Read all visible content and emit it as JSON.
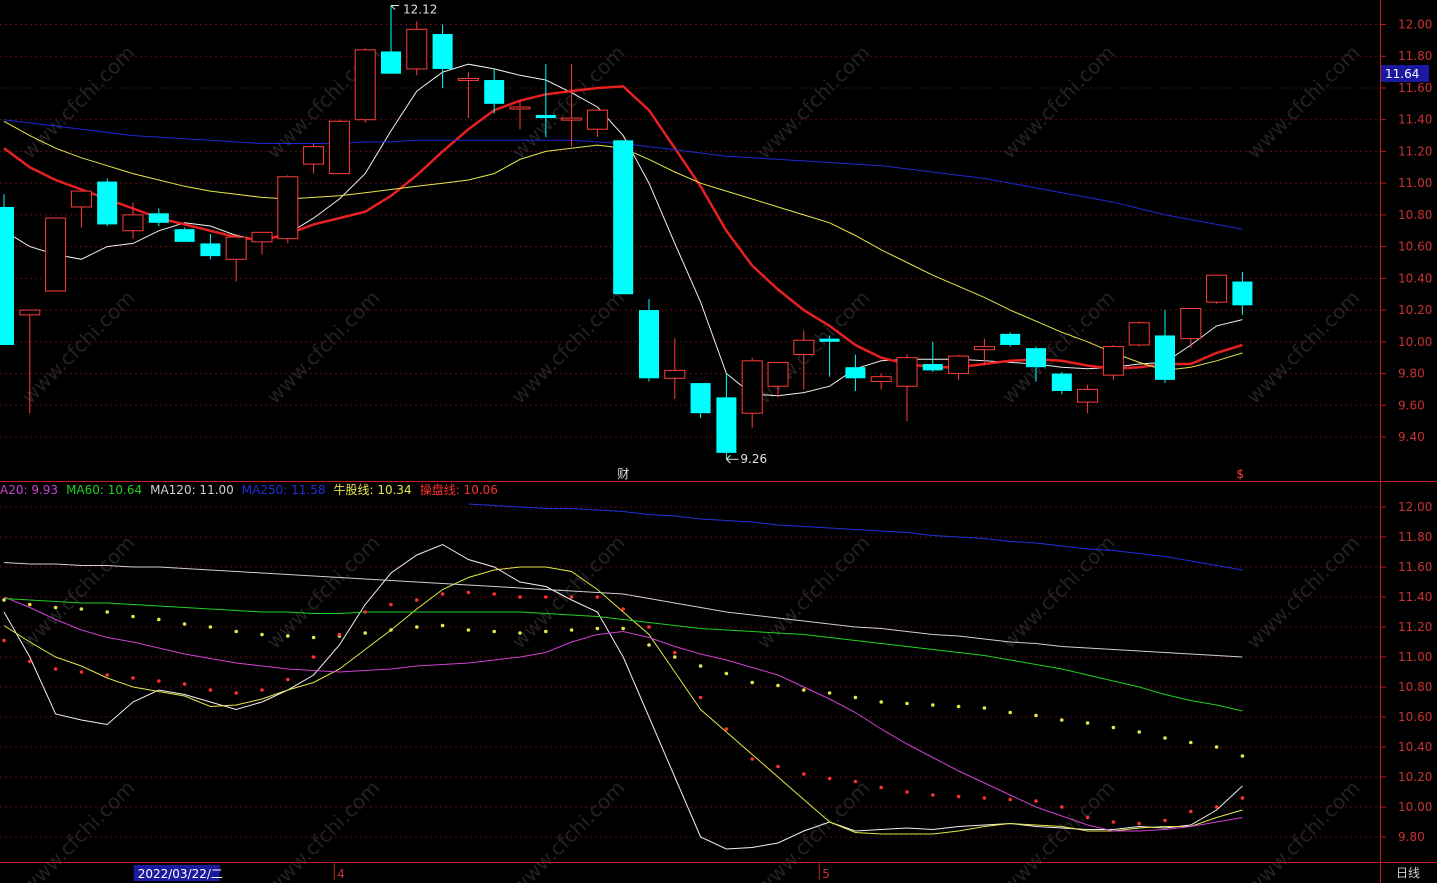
{
  "chart_data": [
    {
      "type": "candlestick",
      "ylim": [
        9.2,
        12.1
      ],
      "y_ticks": [
        "12.00",
        "11.80",
        "11.60",
        "11.40",
        "11.20",
        "11.00",
        "10.80",
        "10.60",
        "10.40",
        "10.20",
        "10.00",
        "9.80",
        "9.60",
        "9.40"
      ],
      "current_price": "11.64",
      "high_label": "12.12",
      "low_label": "9.26",
      "event_markers": [
        {
          "label": "财",
          "index": 24
        },
        {
          "label": "$",
          "index": 48
        }
      ],
      "candles": [
        {
          "o": 10.85,
          "h": 10.93,
          "l": 10.0,
          "c": 9.98
        },
        {
          "o": 10.17,
          "h": 10.19,
          "l": 9.55,
          "c": 10.2
        },
        {
          "o": 10.32,
          "h": 10.77,
          "l": 10.35,
          "c": 10.78
        },
        {
          "o": 10.85,
          "h": 10.92,
          "l": 10.72,
          "c": 10.95
        },
        {
          "o": 11.01,
          "h": 11.03,
          "l": 10.73,
          "c": 10.74
        },
        {
          "o": 10.7,
          "h": 10.88,
          "l": 10.65,
          "c": 10.8
        },
        {
          "o": 10.81,
          "h": 10.84,
          "l": 10.73,
          "c": 10.75
        },
        {
          "o": 10.71,
          "h": 10.72,
          "l": 10.63,
          "c": 10.63
        },
        {
          "o": 10.62,
          "h": 10.68,
          "l": 10.52,
          "c": 10.54
        },
        {
          "o": 10.52,
          "h": 10.68,
          "l": 10.38,
          "c": 10.66
        },
        {
          "o": 10.63,
          "h": 10.69,
          "l": 10.55,
          "c": 10.69
        },
        {
          "o": 10.65,
          "h": 11.05,
          "l": 10.62,
          "c": 11.04
        },
        {
          "o": 11.12,
          "h": 11.25,
          "l": 11.06,
          "c": 11.23
        },
        {
          "o": 11.06,
          "h": 11.4,
          "l": 11.06,
          "c": 11.39
        },
        {
          "o": 11.4,
          "h": 11.85,
          "l": 11.38,
          "c": 11.84
        },
        {
          "o": 11.83,
          "h": 12.12,
          "l": 11.73,
          "c": 11.69
        },
        {
          "o": 11.72,
          "h": 12.02,
          "l": 11.68,
          "c": 11.97
        },
        {
          "o": 11.94,
          "h": 12.0,
          "l": 11.6,
          "c": 11.72
        },
        {
          "o": 11.66,
          "h": 11.7,
          "l": 11.41,
          "c": 11.66
        },
        {
          "o": 11.65,
          "h": 11.72,
          "l": 11.44,
          "c": 11.5
        },
        {
          "o": 11.48,
          "h": 11.52,
          "l": 11.34,
          "c": 11.48
        },
        {
          "o": 11.43,
          "h": 11.75,
          "l": 11.29,
          "c": 11.41
        },
        {
          "o": 11.41,
          "h": 11.75,
          "l": 11.23,
          "c": 11.41
        },
        {
          "o": 11.34,
          "h": 11.46,
          "l": 11.29,
          "c": 11.46
        },
        {
          "o": 11.27,
          "h": 11.27,
          "l": 10.3,
          "c": 10.3
        },
        {
          "o": 10.2,
          "h": 10.27,
          "l": 9.75,
          "c": 9.77
        },
        {
          "o": 9.77,
          "h": 10.02,
          "l": 9.64,
          "c": 9.82
        },
        {
          "o": 9.74,
          "h": 9.74,
          "l": 9.52,
          "c": 9.55
        },
        {
          "o": 9.65,
          "h": 9.8,
          "l": 9.26,
          "c": 9.3
        },
        {
          "o": 9.55,
          "h": 9.9,
          "l": 9.46,
          "c": 9.88
        },
        {
          "o": 9.72,
          "h": 9.84,
          "l": 9.65,
          "c": 9.87
        },
        {
          "o": 9.92,
          "h": 10.07,
          "l": 9.7,
          "c": 10.01
        },
        {
          "o": 10.02,
          "h": 10.04,
          "l": 9.78,
          "c": 10.0
        },
        {
          "o": 9.84,
          "h": 9.92,
          "l": 9.69,
          "c": 9.77
        },
        {
          "o": 9.75,
          "h": 9.8,
          "l": 9.7,
          "c": 9.78
        },
        {
          "o": 9.72,
          "h": 9.92,
          "l": 9.5,
          "c": 9.9
        },
        {
          "o": 9.86,
          "h": 10.0,
          "l": 9.81,
          "c": 9.82
        },
        {
          "o": 9.8,
          "h": 9.92,
          "l": 9.76,
          "c": 9.91
        },
        {
          "o": 9.95,
          "h": 10.02,
          "l": 9.85,
          "c": 9.97
        },
        {
          "o": 10.05,
          "h": 10.06,
          "l": 9.97,
          "c": 9.98
        },
        {
          "o": 9.96,
          "h": 9.97,
          "l": 9.75,
          "c": 9.84
        },
        {
          "o": 9.8,
          "h": 9.81,
          "l": 9.67,
          "c": 9.69
        },
        {
          "o": 9.62,
          "h": 9.73,
          "l": 9.55,
          "c": 9.7
        },
        {
          "o": 9.79,
          "h": 9.98,
          "l": 9.76,
          "c": 9.97
        },
        {
          "o": 9.98,
          "h": 10.13,
          "l": 9.97,
          "c": 10.12
        },
        {
          "o": 10.04,
          "h": 10.2,
          "l": 9.74,
          "c": 9.76
        },
        {
          "o": 10.02,
          "h": 10.21,
          "l": 9.96,
          "c": 10.21
        },
        {
          "o": 10.25,
          "h": 10.42,
          "l": 10.24,
          "c": 10.42
        },
        {
          "o": 10.38,
          "h": 10.44,
          "l": 10.17,
          "c": 10.23
        }
      ],
      "lines": [
        {
          "name": "MA5",
          "color": "#f0f0f0",
          "width": 1,
          "values": [
            10.7,
            10.6,
            10.55,
            10.52,
            10.6,
            10.62,
            10.7,
            10.75,
            10.73,
            10.67,
            10.64,
            10.68,
            10.78,
            10.9,
            11.06,
            11.33,
            11.58,
            11.7,
            11.75,
            11.72,
            11.68,
            11.65,
            11.57,
            11.48,
            11.3,
            11.0,
            10.62,
            10.25,
            9.8,
            9.67,
            9.66,
            9.68,
            9.72,
            9.83,
            9.88,
            9.89,
            9.89,
            9.89,
            9.88,
            9.87,
            9.86,
            9.84,
            9.83,
            9.84,
            9.86,
            9.87,
            9.98,
            10.1,
            10.14
          ]
        },
        {
          "name": "MA10",
          "color": "#e82020",
          "width": 2.5,
          "values": [
            11.22,
            11.1,
            11.02,
            10.96,
            10.9,
            10.84,
            10.78,
            10.74,
            10.7,
            10.66,
            10.64,
            10.68,
            10.74,
            10.78,
            10.82,
            10.92,
            11.05,
            11.2,
            11.34,
            11.46,
            11.52,
            11.56,
            11.58,
            11.6,
            11.61,
            11.46,
            11.22,
            10.98,
            10.7,
            10.48,
            10.33,
            10.2,
            10.1,
            9.98,
            9.9,
            9.86,
            9.84,
            9.84,
            9.86,
            9.88,
            9.89,
            9.88,
            9.85,
            9.83,
            9.84,
            9.86,
            9.86,
            9.93,
            9.98
          ]
        },
        {
          "name": "MA30",
          "color": "#e6e64a",
          "width": 1,
          "values": [
            11.39,
            11.3,
            11.22,
            11.16,
            11.11,
            11.06,
            11.02,
            10.98,
            10.95,
            10.93,
            10.91,
            10.9,
            10.91,
            10.92,
            10.94,
            10.96,
            10.98,
            11.0,
            11.02,
            11.06,
            11.15,
            11.2,
            11.22,
            11.24,
            11.22,
            11.15,
            11.07,
            11.0,
            10.95,
            10.9,
            10.85,
            10.8,
            10.75,
            10.67,
            10.58,
            10.5,
            10.42,
            10.35,
            10.28,
            10.2,
            10.13,
            10.06,
            10.0,
            9.93,
            9.87,
            9.82,
            9.84,
            9.88,
            9.93
          ]
        },
        {
          "name": "MA250",
          "color": "#1f27d2",
          "width": 1,
          "values": [
            11.4,
            11.38,
            11.36,
            11.34,
            11.32,
            11.3,
            11.29,
            11.28,
            11.27,
            11.26,
            11.25,
            11.25,
            11.25,
            11.25,
            11.26,
            11.26,
            11.27,
            11.27,
            11.27,
            11.27,
            11.27,
            11.27,
            11.27,
            11.26,
            11.25,
            11.23,
            11.21,
            11.19,
            11.17,
            11.16,
            11.15,
            11.14,
            11.13,
            11.12,
            11.11,
            11.09,
            11.07,
            11.05,
            11.03,
            11.0,
            10.97,
            10.94,
            10.91,
            10.88,
            10.84,
            10.8,
            10.77,
            10.74,
            10.71
          ]
        }
      ]
    },
    {
      "type": "line",
      "ylim": [
        9.7,
        12.15
      ],
      "y_ticks": [
        "12.00",
        "11.80",
        "11.60",
        "11.40",
        "11.20",
        "11.00",
        "10.80",
        "10.60",
        "10.40",
        "10.20",
        "10.00",
        "9.80"
      ],
      "legend": [
        {
          "text": "A20: 9.93",
          "color": "#d040d0"
        },
        {
          "text": "MA60: 10.64",
          "color": "#20d020"
        },
        {
          "text": "MA120: 11.00",
          "color": "#d0d0d0"
        },
        {
          "text": "MA250: 11.58",
          "color": "#2030e0"
        },
        {
          "text": "牛股线: 10.34",
          "color": "#e6e64a"
        },
        {
          "text": "操盘线: 10.06",
          "color": "#ff3030"
        }
      ],
      "series": [
        {
          "name": "MA5",
          "color": "#f0f0f0",
          "style": "line",
          "values": [
            11.3,
            11.0,
            10.62,
            10.58,
            10.55,
            10.7,
            10.78,
            10.75,
            10.7,
            10.65,
            10.7,
            10.78,
            10.88,
            11.08,
            11.35,
            11.56,
            11.68,
            11.75,
            11.65,
            11.6,
            11.5,
            11.47,
            11.38,
            11.3,
            11.0,
            10.6,
            10.2,
            9.8,
            9.72,
            9.73,
            9.76,
            9.84,
            9.9,
            9.84,
            9.85,
            9.86,
            9.85,
            9.87,
            9.88,
            9.89,
            9.87,
            9.86,
            9.85,
            9.85,
            9.87,
            9.86,
            9.88,
            9.98,
            10.14
          ]
        },
        {
          "name": "MA10",
          "color": "#e6e64a",
          "style": "line",
          "values": [
            11.21,
            11.1,
            11.0,
            10.94,
            10.86,
            10.8,
            10.77,
            10.74,
            10.67,
            10.68,
            10.72,
            10.78,
            10.83,
            10.92,
            11.05,
            11.18,
            11.32,
            11.45,
            11.53,
            11.58,
            11.6,
            11.6,
            11.57,
            11.45,
            11.3,
            11.15,
            10.9,
            10.65,
            10.5,
            10.35,
            10.2,
            10.05,
            9.9,
            9.83,
            9.82,
            9.82,
            9.82,
            9.84,
            9.87,
            9.89,
            9.88,
            9.87,
            9.84,
            9.84,
            9.86,
            9.87,
            9.87,
            9.93,
            9.98
          ]
        },
        {
          "name": "MA20",
          "color": "#d040d0",
          "style": "line",
          "values": [
            11.4,
            11.33,
            11.25,
            11.18,
            11.13,
            11.1,
            11.06,
            11.02,
            10.99,
            10.96,
            10.94,
            10.92,
            10.91,
            10.9,
            10.91,
            10.92,
            10.94,
            10.95,
            10.96,
            10.98,
            11.0,
            11.03,
            11.1,
            11.15,
            11.17,
            11.13,
            11.07,
            11.02,
            10.98,
            10.93,
            10.88,
            10.8,
            10.72,
            10.63,
            10.52,
            10.42,
            10.33,
            10.24,
            10.16,
            10.08,
            10.0,
            9.94,
            9.88,
            9.84,
            9.84,
            9.85,
            9.87,
            9.9,
            9.93
          ]
        },
        {
          "name": "MA60",
          "color": "#20d020",
          "style": "line",
          "values": [
            11.39,
            11.38,
            11.37,
            11.36,
            11.36,
            11.35,
            11.34,
            11.33,
            11.32,
            11.31,
            11.3,
            11.3,
            11.29,
            11.29,
            11.3,
            11.3,
            11.3,
            11.3,
            11.3,
            11.3,
            11.3,
            11.29,
            11.28,
            11.27,
            11.25,
            11.23,
            11.21,
            11.19,
            11.18,
            11.17,
            11.16,
            11.15,
            11.13,
            11.11,
            11.09,
            11.07,
            11.05,
            11.03,
            11.01,
            10.98,
            10.95,
            10.92,
            10.88,
            10.84,
            10.8,
            10.75,
            10.71,
            10.68,
            10.64
          ]
        },
        {
          "name": "MA120",
          "color": "#d0d0d0",
          "style": "line",
          "values": [
            11.63,
            11.62,
            11.62,
            11.61,
            11.61,
            11.6,
            11.6,
            11.59,
            11.58,
            11.57,
            11.56,
            11.55,
            11.54,
            11.53,
            11.52,
            11.51,
            11.5,
            11.49,
            11.48,
            11.47,
            11.46,
            11.45,
            11.44,
            11.43,
            11.42,
            11.39,
            11.36,
            11.33,
            11.3,
            11.28,
            11.26,
            11.24,
            11.22,
            11.2,
            11.19,
            11.17,
            11.15,
            11.14,
            11.12,
            11.1,
            11.09,
            11.07,
            11.06,
            11.05,
            11.04,
            11.03,
            11.02,
            11.01,
            11.0
          ]
        },
        {
          "name": "MA250",
          "color": "#2030e0",
          "style": "line",
          "values": [
            null,
            null,
            null,
            null,
            null,
            null,
            null,
            null,
            null,
            null,
            null,
            null,
            null,
            null,
            null,
            null,
            null,
            null,
            12.02,
            12.01,
            12.0,
            11.99,
            11.99,
            11.98,
            11.97,
            11.95,
            11.94,
            11.92,
            11.91,
            11.9,
            11.88,
            11.87,
            11.86,
            11.85,
            11.84,
            11.83,
            11.81,
            11.8,
            11.79,
            11.77,
            11.76,
            11.74,
            11.72,
            11.71,
            11.69,
            11.67,
            11.64,
            11.61,
            11.58
          ]
        },
        {
          "name": "牛股线",
          "color": "#e6e64a",
          "style": "dots",
          "values": [
            11.38,
            11.35,
            11.33,
            11.32,
            11.3,
            11.27,
            11.25,
            11.22,
            11.2,
            11.17,
            11.15,
            11.14,
            11.13,
            11.14,
            11.16,
            11.18,
            11.2,
            11.21,
            11.18,
            11.17,
            11.16,
            11.17,
            11.18,
            11.19,
            11.19,
            11.08,
            11.0,
            10.94,
            10.89,
            10.83,
            10.81,
            10.78,
            10.76,
            10.73,
            10.7,
            10.69,
            10.68,
            10.67,
            10.66,
            10.63,
            10.61,
            10.58,
            10.56,
            10.53,
            10.5,
            10.46,
            10.43,
            10.4,
            10.34
          ]
        },
        {
          "name": "操盘线",
          "color": "#ff3030",
          "style": "dots",
          "values": [
            11.11,
            10.97,
            10.92,
            10.9,
            10.88,
            10.86,
            10.84,
            10.82,
            10.78,
            10.76,
            10.78,
            10.85,
            11.0,
            11.15,
            11.3,
            11.35,
            11.38,
            11.42,
            11.43,
            11.42,
            11.4,
            11.4,
            11.4,
            11.4,
            11.32,
            11.2,
            11.03,
            10.73,
            10.52,
            10.32,
            10.27,
            10.22,
            10.19,
            10.17,
            10.13,
            10.1,
            10.08,
            10.07,
            10.06,
            10.05,
            10.04,
            10.0,
            9.93,
            9.9,
            9.89,
            9.91,
            9.97,
            10.0,
            10.06
          ]
        }
      ],
      "x_labels": [
        {
          "text": "2022/03/22/二",
          "index": 6.5
        },
        {
          "text": "4",
          "index": 12.8
        },
        {
          "text": "5",
          "index": 31.6
        }
      ],
      "period_label": "日线"
    }
  ],
  "watermark": "www.cfchi.com"
}
